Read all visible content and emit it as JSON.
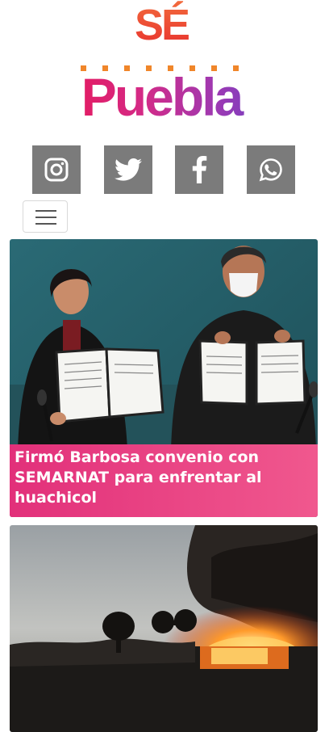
{
  "header": {
    "logo_top": "SÉ",
    "logo_bottom": "Puebla"
  },
  "social": [
    {
      "name": "instagram-icon"
    },
    {
      "name": "twitter-icon"
    },
    {
      "name": "facebook-icon"
    },
    {
      "name": "whatsapp-icon"
    }
  ],
  "nav": {
    "toggle_icon": "hamburger-menu-icon"
  },
  "articles": [
    {
      "title": "Firmó Barbosa convenio con SEMARNAT para enfrentar al huachicol",
      "image": "two officials holding signed agreements"
    },
    {
      "title": "",
      "image": "fire burning at dusk"
    }
  ],
  "colors": {
    "social_bg": "#7b7b7b",
    "caption_gradient_start": "#e2307a",
    "caption_gradient_end": "#f0588e",
    "logo_orange": "#f0862a",
    "logo_pink": "#e6195c",
    "logo_purple": "#7a3fbf"
  }
}
